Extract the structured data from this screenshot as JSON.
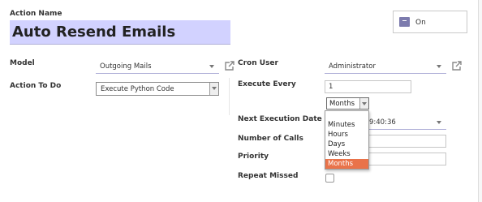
{
  "action_name": {
    "label": "Action Name",
    "value": "Auto Resend Emails"
  },
  "active_toggle": {
    "label": "On"
  },
  "model": {
    "label": "Model",
    "value": "Outgoing Mails"
  },
  "action_to_do": {
    "label": "Action To Do",
    "value": "Execute Python Code"
  },
  "cron_user": {
    "label": "Cron User",
    "value": "Administrator"
  },
  "execute_every": {
    "label": "Execute Every",
    "value": "1",
    "unit": "Months"
  },
  "interval_options": [
    "Minutes",
    "Hours",
    "Days",
    "Weeks",
    "Months"
  ],
  "interval_selected": "Months",
  "next_execution_date": {
    "label": "Next Execution Date",
    "value_visible": "9:40:36"
  },
  "number_of_calls": {
    "label": "Number of Calls"
  },
  "priority": {
    "label": "Priority"
  },
  "repeat_missed": {
    "label": "Repeat Missed"
  },
  "colors": {
    "required_bg": "#d2d2ff",
    "selected_option": "#e9734a"
  },
  "icons": [
    "external-link-icon",
    "archive-icon",
    "dropdown-caret-icon"
  ]
}
